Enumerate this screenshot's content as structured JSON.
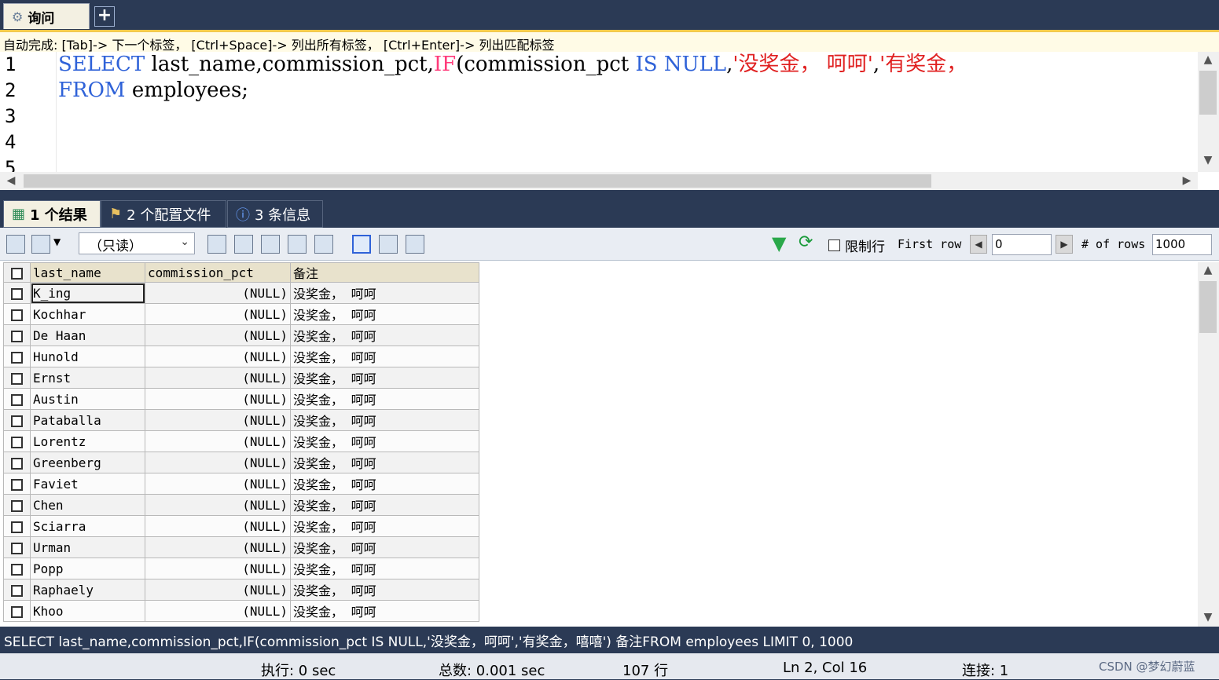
{
  "top_tabs": {
    "query_label": "询问",
    "add_label": "+"
  },
  "hint": "自动完成:  [Tab]-> 下一个标签， [Ctrl+Space]-> 列出所有标签， [Ctrl+Enter]-> 列出匹配标签",
  "editor": {
    "line_numbers": [
      "1",
      "2",
      "3",
      "4",
      "5"
    ],
    "line1": {
      "kw_select": "SELECT",
      "t1": " last_name,commission_pct,",
      "fn_if": "IF",
      "t2": "(commission_pct ",
      "kw_is": "IS",
      "t3": " ",
      "kw_null": "NULL",
      "t4": ",",
      "s1": "'没奖金， 呵呵'",
      "t5": ",",
      "s2": "'有奖金，"
    },
    "line2": {
      "kw_from": "FROM",
      "t1": " employees;"
    }
  },
  "result_tabs": [
    {
      "label": "1 个结果",
      "icon": "result-table-icon"
    },
    {
      "label": "2 个配置文件",
      "icon": "profile-icon"
    },
    {
      "label": "3 条信息",
      "icon": "info-icon"
    }
  ],
  "toolbar": {
    "mode": "（只读）",
    "limit_label": "限制行",
    "first_row_label": "First row",
    "first_row_value": "0",
    "num_rows_label": "# of rows",
    "num_rows_value": "1000"
  },
  "grid": {
    "columns": [
      "last_name",
      "commission_pct",
      "备注"
    ],
    "rows": [
      [
        "K_ing",
        "(NULL)",
        "没奖金， 呵呵"
      ],
      [
        "Kochhar",
        "(NULL)",
        "没奖金， 呵呵"
      ],
      [
        "De Haan",
        "(NULL)",
        "没奖金， 呵呵"
      ],
      [
        "Hunold",
        "(NULL)",
        "没奖金， 呵呵"
      ],
      [
        "Ernst",
        "(NULL)",
        "没奖金， 呵呵"
      ],
      [
        "Austin",
        "(NULL)",
        "没奖金， 呵呵"
      ],
      [
        "Pataballa",
        "(NULL)",
        "没奖金， 呵呵"
      ],
      [
        "Lorentz",
        "(NULL)",
        "没奖金， 呵呵"
      ],
      [
        "Greenberg",
        "(NULL)",
        "没奖金， 呵呵"
      ],
      [
        "Faviet",
        "(NULL)",
        "没奖金， 呵呵"
      ],
      [
        "Chen",
        "(NULL)",
        "没奖金， 呵呵"
      ],
      [
        "Sciarra",
        "(NULL)",
        "没奖金， 呵呵"
      ],
      [
        "Urman",
        "(NULL)",
        "没奖金， 呵呵"
      ],
      [
        "Popp",
        "(NULL)",
        "没奖金， 呵呵"
      ],
      [
        "Raphaely",
        "(NULL)",
        "没奖金， 呵呵"
      ],
      [
        "Khoo",
        "(NULL)",
        "没奖金， 呵呵"
      ]
    ]
  },
  "sql_echo": "SELECT last_name,commission_pct,IF(commission_pct IS NULL,'没奖金，呵呵','有奖金，嘻嘻') 备注FROM employees LIMIT 0, 1000",
  "status": {
    "exec": "执行: 0 sec",
    "total": "总数: 0.001 sec",
    "rows": "107 行",
    "cursor": "Ln 2, Col 16",
    "connection": "连接: 1",
    "watermark": "CSDN @梦幻蔚蓝"
  }
}
